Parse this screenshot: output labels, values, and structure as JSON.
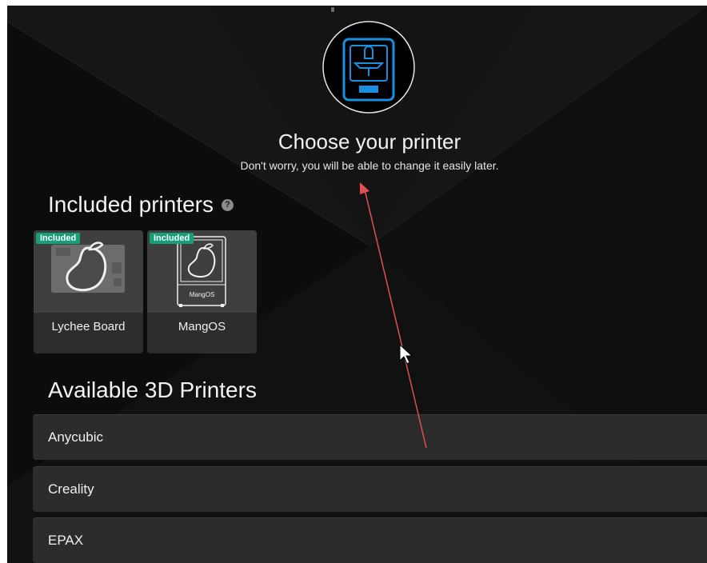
{
  "header": {
    "title": "Choose your printer",
    "subtitle": "Don't worry, you will be able to change it easily later.",
    "hero_icon": "printer-icon"
  },
  "included": {
    "heading": "Included printers",
    "help_icon": "?",
    "cards": [
      {
        "badge": "Included",
        "label": "Lychee Board",
        "icon": "mango-board-icon"
      },
      {
        "badge": "Included",
        "label": "MangOS",
        "icon": "mango-printer-icon",
        "screen_text": "MangOS"
      }
    ]
  },
  "available": {
    "heading": "Available 3D Printers",
    "brands": [
      "Anycubic",
      "Creality",
      "EPAX"
    ]
  },
  "colors": {
    "accent_blue": "#1a8fe0",
    "badge_green": "#16a07a",
    "annotation_red": "#e05050"
  }
}
